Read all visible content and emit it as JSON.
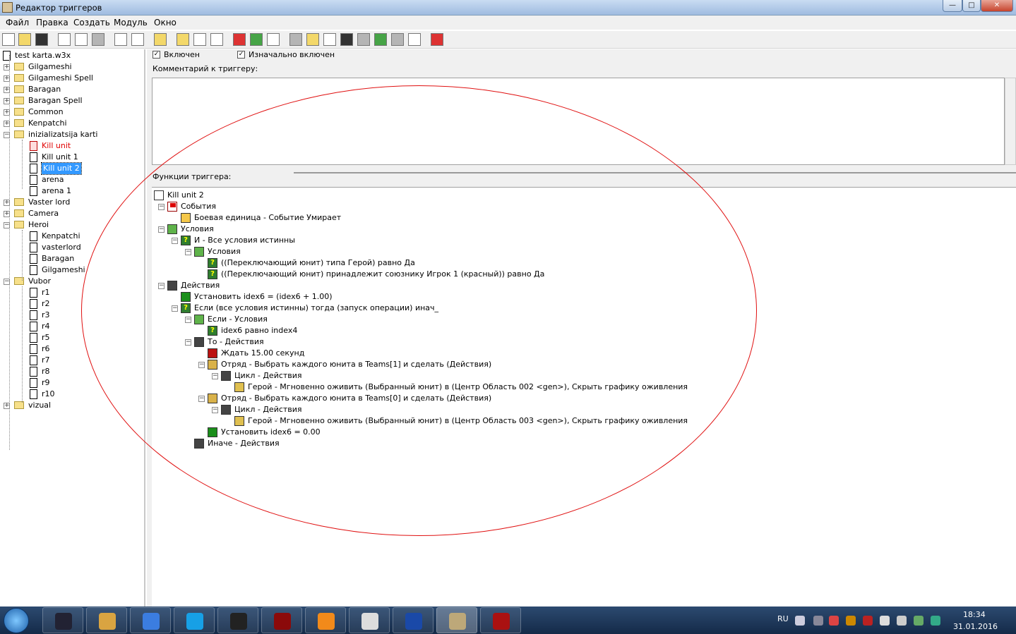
{
  "window": {
    "title": "Редактор триггеров",
    "min_label": "—",
    "max_label": "□",
    "close_label": "✕"
  },
  "menu": [
    "Файл",
    "Правка",
    "Создать",
    "Модуль",
    "Окно"
  ],
  "tree": {
    "root": "test karta.w3x",
    "items": [
      {
        "label": "Gilgameshi",
        "type": "folder",
        "expanded": false
      },
      {
        "label": "Gilgameshi Spell",
        "type": "folder",
        "expanded": false
      },
      {
        "label": "Baragan",
        "type": "folder",
        "expanded": false
      },
      {
        "label": "Baragan Spell",
        "type": "folder",
        "expanded": false
      },
      {
        "label": "Common",
        "type": "folder",
        "expanded": false
      },
      {
        "label": "Kenpatchi",
        "type": "folder",
        "expanded": false
      },
      {
        "label": "inizializatsija karti",
        "type": "folder",
        "expanded": true
      },
      {
        "label": "Kill unit",
        "type": "trigger-disabled"
      },
      {
        "label": "Kill unit 1",
        "type": "trigger"
      },
      {
        "label": "Kill unit 2",
        "type": "trigger",
        "selected": true
      },
      {
        "label": "arena",
        "type": "trigger"
      },
      {
        "label": "arena 1",
        "type": "trigger"
      },
      {
        "label": "Vaster lord",
        "type": "folder",
        "expanded": false
      },
      {
        "label": "Camera",
        "type": "folder",
        "expanded": false
      },
      {
        "label": "Heroi",
        "type": "folder",
        "expanded": true
      },
      {
        "label": "Kenpatchi",
        "type": "trigger"
      },
      {
        "label": "vasterlord",
        "type": "trigger"
      },
      {
        "label": "Baragan",
        "type": "trigger"
      },
      {
        "label": "Gilgameshi",
        "type": "trigger"
      },
      {
        "label": "Vubor",
        "type": "folder",
        "expanded": true
      },
      {
        "label": "r1",
        "type": "trigger"
      },
      {
        "label": "r2",
        "type": "trigger"
      },
      {
        "label": "r3",
        "type": "trigger"
      },
      {
        "label": "r4",
        "type": "trigger"
      },
      {
        "label": "r5",
        "type": "trigger"
      },
      {
        "label": "r6",
        "type": "trigger"
      },
      {
        "label": "r7",
        "type": "trigger"
      },
      {
        "label": "r8",
        "type": "trigger"
      },
      {
        "label": "r9",
        "type": "trigger"
      },
      {
        "label": "r10",
        "type": "trigger"
      },
      {
        "label": "vizual",
        "type": "folder",
        "expanded": false
      }
    ]
  },
  "options": {
    "enabled_label": "Включен",
    "initially_on_label": "Изначально включен",
    "check": "✓"
  },
  "comment": {
    "label": "Комментарий к триггеру:"
  },
  "functions": {
    "label": "Функции триггера:",
    "items": [
      {
        "text": "Kill unit 2",
        "icon": "trigger-doc-icon"
      },
      {
        "text": "События",
        "icon": "event-flag-icon"
      },
      {
        "text": "Боевая единица - Событие Умирает",
        "icon": "unit-event-icon"
      },
      {
        "text": "Условия",
        "icon": "conditions-icon"
      },
      {
        "text": "И - Все условия истинны",
        "icon": "condition-and-icon"
      },
      {
        "text": "Условия",
        "icon": "conditions-icon"
      },
      {
        "text": "((Переключающий юнит) типа Герой) равно Да",
        "icon": "condition-icon"
      },
      {
        "text": "((Переключающий юнит) принадлежит союзнику Игрок 1 (красный)) равно Да",
        "icon": "condition-icon"
      },
      {
        "text": "Действия",
        "icon": "actions-icon"
      },
      {
        "text": "Установить idex6 = (idex6 + 1.00)",
        "icon": "set-variable-icon"
      },
      {
        "text": "Если (все условия истинны) тогда (запуск операции) инач_",
        "icon": "if-then-else-icon"
      },
      {
        "text": "Если - Условия",
        "icon": "conditions-icon"
      },
      {
        "text": "idex6 равно index4",
        "icon": "condition-icon"
      },
      {
        "text": "То - Действия",
        "icon": "actions-icon"
      },
      {
        "text": "Ждать 15.00 секунд",
        "icon": "wait-icon"
      },
      {
        "text": "Отряд - Выбрать каждого юнита в Teams[1] и сделать (Действия)",
        "icon": "unit-group-icon"
      },
      {
        "text": "Цикл - Действия",
        "icon": "loop-actions-icon"
      },
      {
        "text": "Герой - Мгновенно оживить (Выбранный юнит) в (Центр Область 002 <gen>), Скрыть графику оживления",
        "icon": "hero-revive-icon"
      },
      {
        "text": "Отряд - Выбрать каждого юнита в Teams[0] и сделать (Действия)",
        "icon": "unit-group-icon"
      },
      {
        "text": "Цикл - Действия",
        "icon": "loop-actions-icon"
      },
      {
        "text": "Герой - Мгновенно оживить (Выбранный юнит) в (Центр Область 003 <gen>), Скрыть графику оживления",
        "icon": "hero-revive-icon"
      },
      {
        "text": "Установить idex6 = 0.00",
        "icon": "set-variable-icon"
      },
      {
        "text": "Иначе - Действия",
        "icon": "actions-icon"
      }
    ]
  },
  "annotation": {
    "color": "#e01010"
  },
  "taskbar": {
    "language": "RU",
    "time": "18:34",
    "date": "31.01.2016",
    "apps": [
      "game-icon",
      "explorer-icon",
      "chrome-icon",
      "skype-icon",
      "browser-icon",
      "game-launcher-icon",
      "vlc-icon",
      "notepad-icon",
      "save-icon",
      "trigger-editor-icon",
      "warcraft-icon"
    ]
  }
}
